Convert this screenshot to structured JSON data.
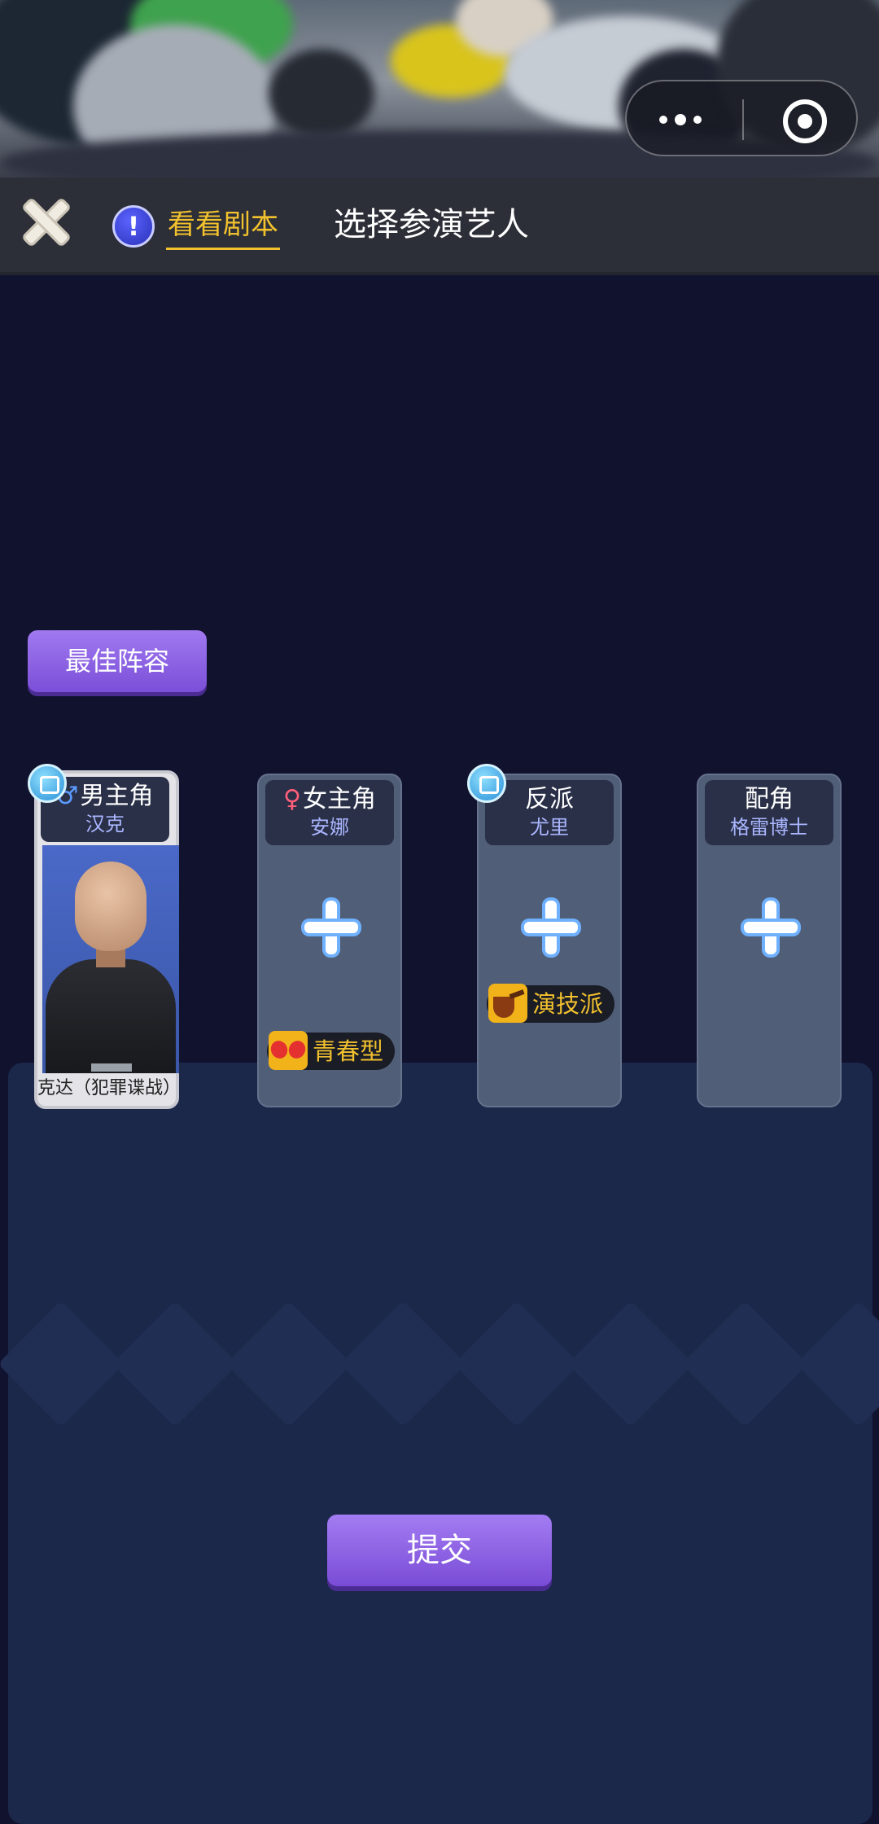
{
  "header": {
    "script_tab": "看看剧本",
    "title": "选择参演艺人"
  },
  "best_lineup_label": "最佳阵容",
  "roles": [
    {
      "role": "男主角",
      "actor": "汉克",
      "gender": "♂",
      "caption": "克达（犯罪谍战）",
      "filled": true
    },
    {
      "role": "女主角",
      "actor": "安娜",
      "gender": "♀",
      "trait": "青春型",
      "filled": false
    },
    {
      "role": "反派",
      "actor": "尤里",
      "trait": "演技派",
      "filled": false
    },
    {
      "role": "配角",
      "actor": "格雷博士",
      "filled": false
    }
  ],
  "submit_label": "提交"
}
